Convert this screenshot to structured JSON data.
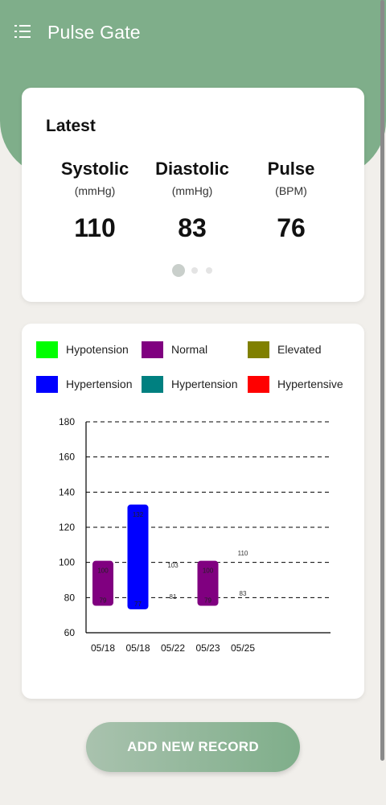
{
  "app": {
    "title": "Pulse Gate",
    "menu_icon": "list-icon",
    "header_color": "#7fae8a"
  },
  "latest": {
    "title": "Latest",
    "metrics": [
      {
        "name": "Systolic",
        "unit": "(mmHg)",
        "value": "110"
      },
      {
        "name": "Diastolic",
        "unit": "(mmHg)",
        "value": "83"
      },
      {
        "name": "Pulse",
        "unit": "(BPM)",
        "value": "76"
      }
    ],
    "pager": {
      "pages": 3,
      "active": 0
    }
  },
  "legend": [
    {
      "label": "Hypotension",
      "color": "#00ff00"
    },
    {
      "label": "Normal",
      "color": "#800080"
    },
    {
      "label": "Elevated",
      "color": "#808000"
    },
    {
      "label": "Hypertension",
      "color": "#0000ff"
    },
    {
      "label": "Hypertension",
      "color": "#008080"
    },
    {
      "label": "Hypertensive",
      "color": "#ff0000"
    }
  ],
  "chart_data": {
    "type": "bar",
    "categories": [
      "05/18",
      "05/18",
      "05/22",
      "05/23",
      "05/25"
    ],
    "ylim": [
      60,
      180
    ],
    "yticks": [
      60,
      80,
      100,
      120,
      140,
      160,
      180
    ],
    "grid": true,
    "series": [
      {
        "systolic": 100,
        "diastolic": 79,
        "color": "#800080",
        "high_label": "100",
        "low_label": "79"
      },
      {
        "systolic": 132,
        "diastolic": 77,
        "color": "#0000ff",
        "high_label": "132",
        "low_label": "77"
      },
      {
        "systolic": 103,
        "diastolic": 81,
        "color": null,
        "high_label": "103",
        "low_label": "81"
      },
      {
        "systolic": 100,
        "diastolic": 79,
        "color": "#800080",
        "high_label": "100",
        "low_label": "79"
      },
      {
        "systolic": 110,
        "diastolic": 83,
        "color": null,
        "high_label": "110",
        "low_label": "83"
      }
    ]
  },
  "actions": {
    "add_record": "ADD NEW RECORD"
  }
}
